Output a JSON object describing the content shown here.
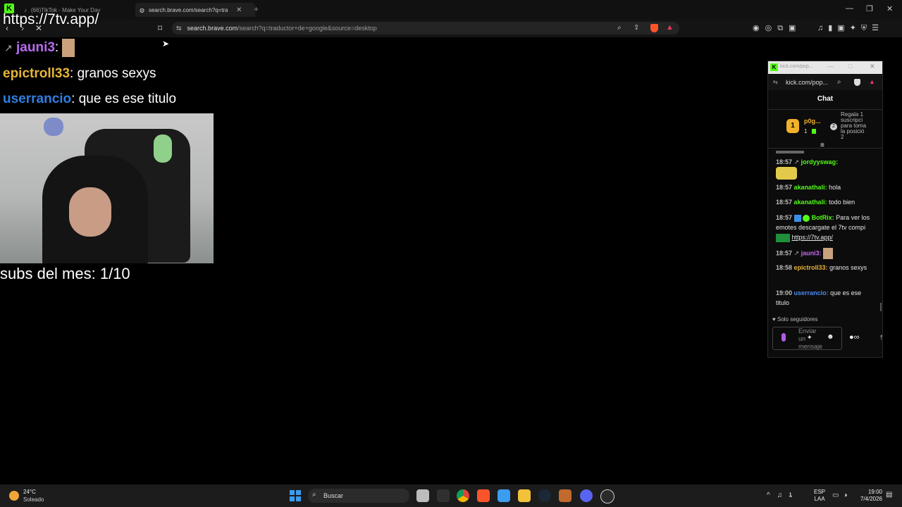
{
  "browser": {
    "tabs": [
      {
        "label": "(66)TikTok - Make Your Day"
      },
      {
        "label": "search.brave.com/search?q=trac"
      }
    ],
    "url_host": "search.brave.com",
    "url_path": "/search?q=traductor+de+google&source=desktop",
    "bookmark_icon": "bookmark-icon"
  },
  "overlay": {
    "banner_text": "https://7tv.app/",
    "chat": [
      {
        "user": "jauni3",
        "text": ":"
      },
      {
        "user": "epictroll33",
        "text": ": granos sexys"
      },
      {
        "user": "userrancio",
        "text": ": que es ese titulo"
      }
    ],
    "subs": "subs del mes: 1/10"
  },
  "popup": {
    "url": "kick.com/pop...",
    "title_url": "kick.com/pop...",
    "chat_title": "Chat",
    "leader_name": "p0g...",
    "leader_count": "1",
    "gift_text": "Regala 1 suscripci para toma la posició 2",
    "messages": [
      {
        "time": "18:57",
        "user": "jordyyswag:",
        "text": ""
      },
      {
        "time": "18:57",
        "user": "akanathali:",
        "text": " hola"
      },
      {
        "time": "18:57",
        "user": "akanathali:",
        "text": " todo bien"
      },
      {
        "time": "18:57",
        "user": "BotRix:",
        "text": " Para ver los emotes descargate el 7tv compi",
        "link": "https://7tv.app/"
      },
      {
        "time": "18:57",
        "user": "jauni3:",
        "text": ""
      },
      {
        "time": "18:58",
        "user": "epictroll33:",
        "text": " granos sexys"
      },
      {
        "time": "19:00",
        "user": "userrancio:",
        "text": " que es ese titulo"
      }
    ],
    "followers_only": "Solo seguidores",
    "input_placeholder": "Enviar un mensaje"
  },
  "taskbar": {
    "weather_temp": "24°C",
    "weather_desc": "Soleado",
    "search_label": "Buscar",
    "lang": "ESP",
    "lang2": "LAA",
    "time": "19:00",
    "date": "7/4/2026"
  },
  "colors": {
    "kick_green": "#53fc18",
    "brave_orange": "#fb542b"
  }
}
